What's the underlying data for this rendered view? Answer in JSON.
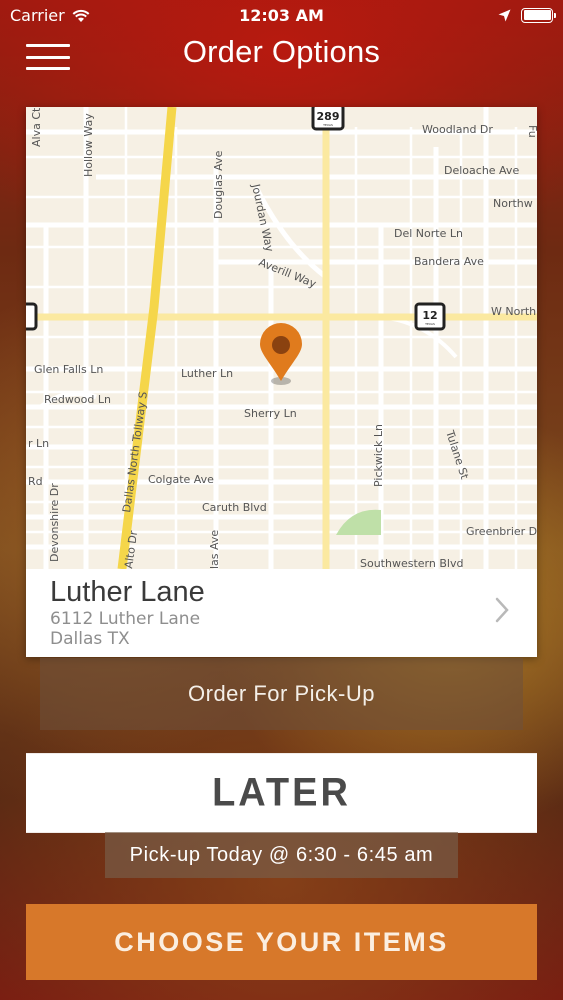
{
  "status_bar": {
    "carrier": "Carrier",
    "time": "12:03 AM",
    "icons": [
      "wifi-icon",
      "location-arrow-icon",
      "battery-icon"
    ]
  },
  "nav": {
    "title": "Order Options",
    "menu_icon": "hamburger-menu-icon"
  },
  "map": {
    "street_labels": [
      "Alva Ct",
      "Hollow Way",
      "Woodland Dr",
      "Deloache Ave",
      "Northw",
      "Douglas Ave",
      "Jourdan Way",
      "Del Norte Ln",
      "Bandera Ave",
      "Averill Way",
      "W North",
      "Glen Falls Ln",
      "Luther Ln",
      "Redwood Ln",
      "Dallas North Tollway S",
      "Sherry Ln",
      "Pickwick Ln",
      "Tulane St",
      "Colgate Ave",
      "Caruth Blvd",
      "Devonshire Dr",
      "Greenbrier D",
      "Southwestern Blvd",
      "Rd",
      "r Ln",
      "Alto Dr",
      "las Ave",
      "Fu"
    ],
    "shields": [
      "289",
      "12"
    ],
    "shield_small_text": "TEXAS",
    "road_color": "#f5d64a",
    "pin_color": "#e07b1d",
    "pin_icon": "map-pin-icon"
  },
  "location": {
    "name": "Luther Lane",
    "address_line1": "6112 Luther Lane",
    "address_line2": "Dallas TX",
    "chevron_icon": "chevron-right-icon"
  },
  "order_type": {
    "label": "Order For Pick-Up"
  },
  "timing": {
    "later_label": "LATER",
    "pickup_time": "Pick-up Today @ 6:30 - 6:45 am"
  },
  "cta": {
    "label": "CHOOSE YOUR ITEMS",
    "color": "#d7782a"
  }
}
